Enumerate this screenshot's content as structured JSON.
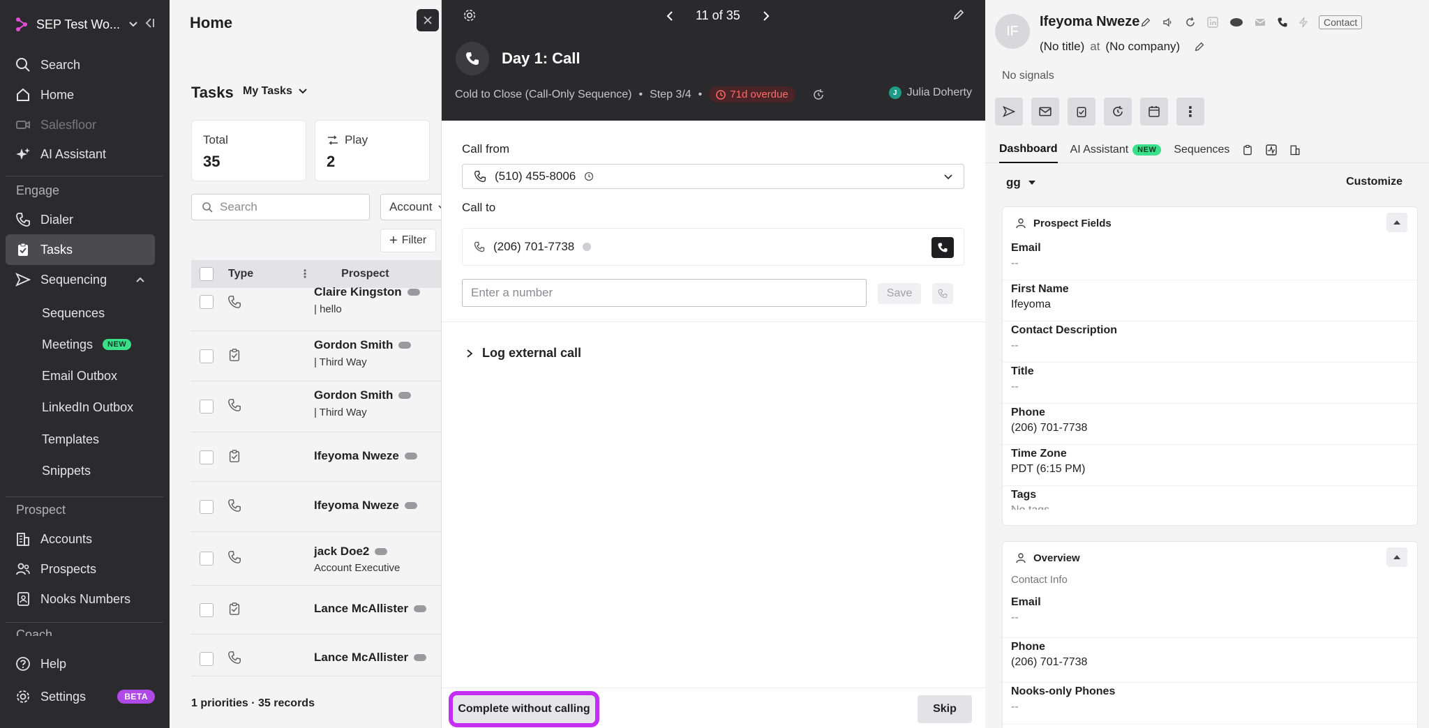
{
  "sidebar": {
    "workspace": "SEP Test Wo...",
    "nav": [
      {
        "label": "Search",
        "icon": "search-icon"
      },
      {
        "label": "Home",
        "icon": "home-icon"
      },
      {
        "label": "Salesfloor",
        "icon": "video-icon",
        "disabled": true
      },
      {
        "label": "AI Assistant",
        "icon": "sparkle-icon"
      }
    ],
    "engage_label": "Engage",
    "engage": [
      {
        "label": "Dialer",
        "icon": "phone-icon"
      },
      {
        "label": "Tasks",
        "icon": "clipboard-icon",
        "active": true
      },
      {
        "label": "Sequencing",
        "icon": "send-icon"
      }
    ],
    "sequencing_sub": [
      "Sequences",
      "Meetings",
      "Email Outbox",
      "LinkedIn Outbox",
      "Templates",
      "Snippets"
    ],
    "new_badge": "NEW",
    "prospect_label": "Prospect",
    "prospect": [
      {
        "label": "Accounts",
        "icon": "building-icon"
      },
      {
        "label": "Prospects",
        "icon": "people-icon"
      },
      {
        "label": "Nooks Numbers",
        "icon": "contact-book-icon"
      }
    ],
    "coach_label": "Coach",
    "help": "Help",
    "settings": "Settings",
    "beta_badge": "BETA"
  },
  "main": {
    "title": "Home",
    "tasks_title": "Tasks",
    "my_tasks": "My Tasks",
    "stats": [
      {
        "label": "Total",
        "value": "35"
      },
      {
        "label": "Play",
        "value": "2"
      }
    ],
    "search_placeholder": "Search",
    "account_filter": "Account",
    "filter": "Filter",
    "columns": {
      "type": "Type",
      "prospect": "Prospect"
    },
    "rows": [
      {
        "type": "phone",
        "name": "Claire Kingston",
        "sub": "| hello"
      },
      {
        "type": "task",
        "name": "Gordon Smith",
        "sub": "| Third Way"
      },
      {
        "type": "phone",
        "name": "Gordon Smith",
        "sub": "| Third Way"
      },
      {
        "type": "task",
        "name": "Ifeyoma Nweze",
        "sub": ""
      },
      {
        "type": "phone",
        "name": "Ifeyoma Nweze",
        "sub": ""
      },
      {
        "type": "phone",
        "name": "jack Doe2",
        "sub": "Account Executive"
      },
      {
        "type": "task",
        "name": "Lance McAllister",
        "sub": ""
      },
      {
        "type": "phone",
        "name": "Lance McAllister",
        "sub": ""
      }
    ],
    "footer": "1 priorities · 35 records"
  },
  "modal": {
    "pager": "11 of 35",
    "title": "Day 1: Call",
    "sequence": "Cold to Close (Call-Only Sequence)",
    "step": "Step 3/4",
    "overdue": "71d overdue",
    "owner": "Julia Doherty",
    "owner_initial": "J",
    "call_from_label": "Call from",
    "call_from_value": "(510) 455-8006",
    "call_to_label": "Call to",
    "call_to_value": "(206) 701-7738",
    "number_placeholder": "Enter a number",
    "save": "Save",
    "log_external": "Log external call",
    "complete_without_calling": "Complete without calling",
    "skip": "Skip"
  },
  "right": {
    "initials": "IF",
    "name": "Ifeyoma Nweze",
    "contact_tag": "Contact",
    "title": "(No title)",
    "at": "at",
    "company": "(No company)",
    "signals": "No signals",
    "tabs": [
      {
        "label": "Dashboard",
        "active": true
      },
      {
        "label": "AI Assistant",
        "badge": "NEW"
      },
      {
        "label": "Sequences"
      }
    ],
    "view": "gg",
    "customize": "Customize",
    "prospect_fields": {
      "title": "Prospect Fields",
      "fields": [
        {
          "label": "Email",
          "value": "--"
        },
        {
          "label": "First Name",
          "value": "Ifeyoma"
        },
        {
          "label": "Contact Description",
          "value": "--"
        },
        {
          "label": "Title",
          "value": "--"
        },
        {
          "label": "Phone",
          "value": "(206) 701-7738"
        },
        {
          "label": "Time Zone",
          "value": "PDT (6:15 PM)"
        },
        {
          "label": "Tags",
          "value": "No tags"
        }
      ]
    },
    "overview": {
      "title": "Overview",
      "sublabel": "Contact Info",
      "fields": [
        {
          "label": "Email",
          "value": "--"
        },
        {
          "label": "Phone",
          "value": "(206) 701-7738"
        },
        {
          "label": "Nooks-only Phones",
          "value": "--"
        }
      ]
    }
  }
}
